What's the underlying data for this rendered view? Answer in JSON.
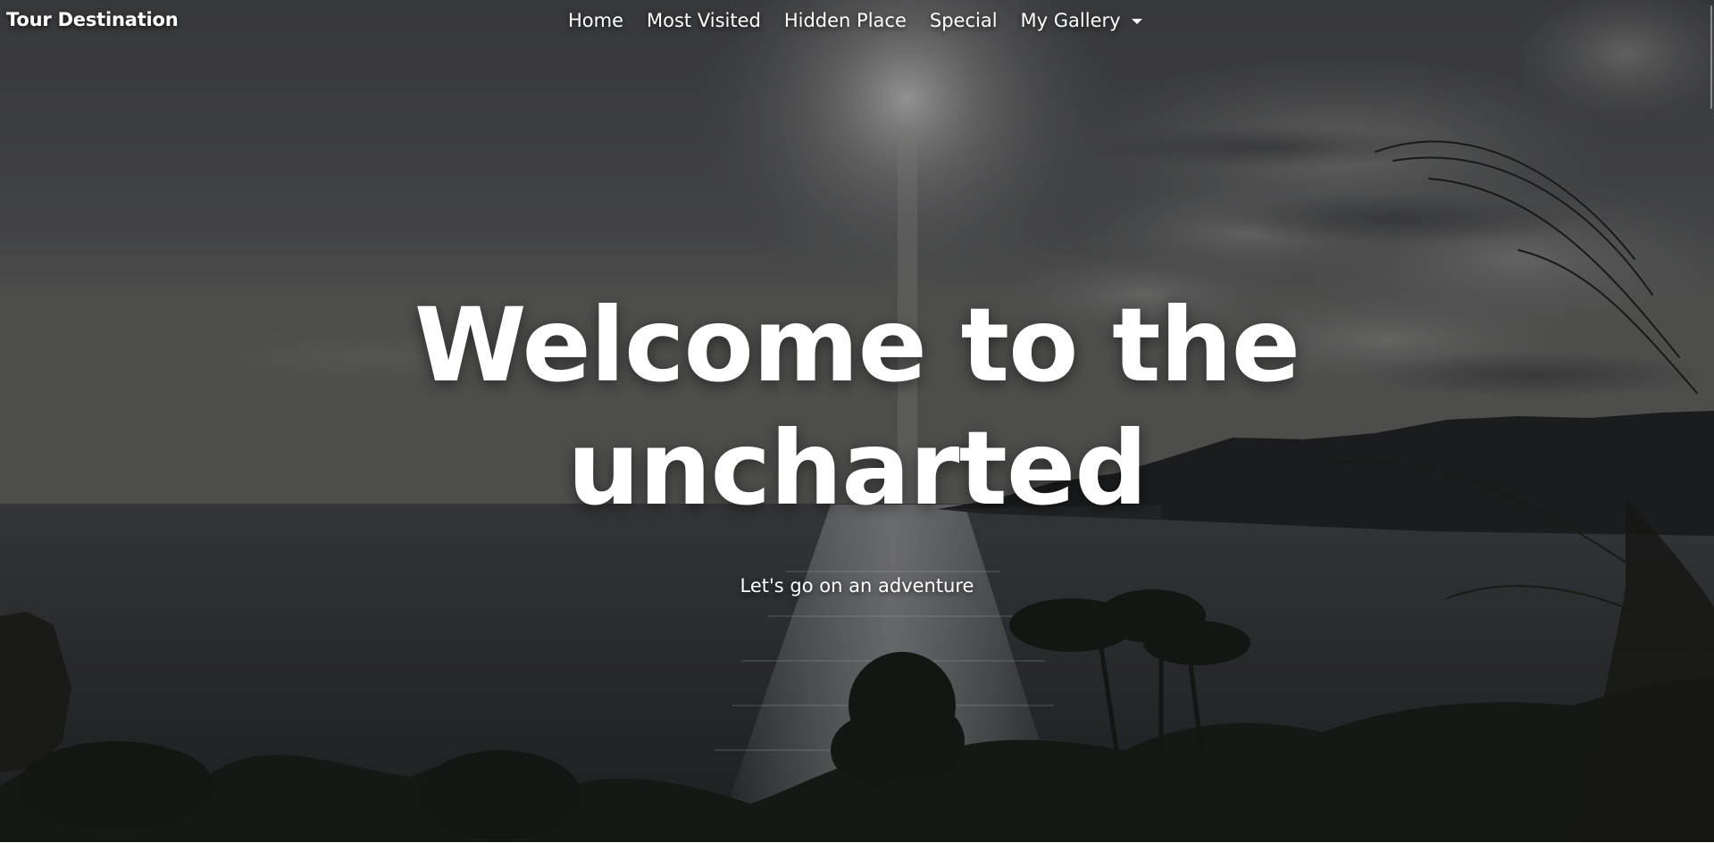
{
  "navbar": {
    "brand": "Tour Destination",
    "links": [
      {
        "label": "Home"
      },
      {
        "label": "Most Visited"
      },
      {
        "label": "Hidden Place"
      },
      {
        "label": "Special"
      },
      {
        "label": "My Gallery",
        "has_dropdown": true
      }
    ]
  },
  "hero": {
    "headline_line1": "Welcome to the",
    "headline_line2": "uncharted",
    "tagline": "Let's go on an adventure",
    "background": "sea-cliff-sunset-photo"
  },
  "colors": {
    "text": "#ffffff",
    "sky": "#4a4b4d",
    "sea": "#2a2c30",
    "land": "#1b1d1a"
  }
}
